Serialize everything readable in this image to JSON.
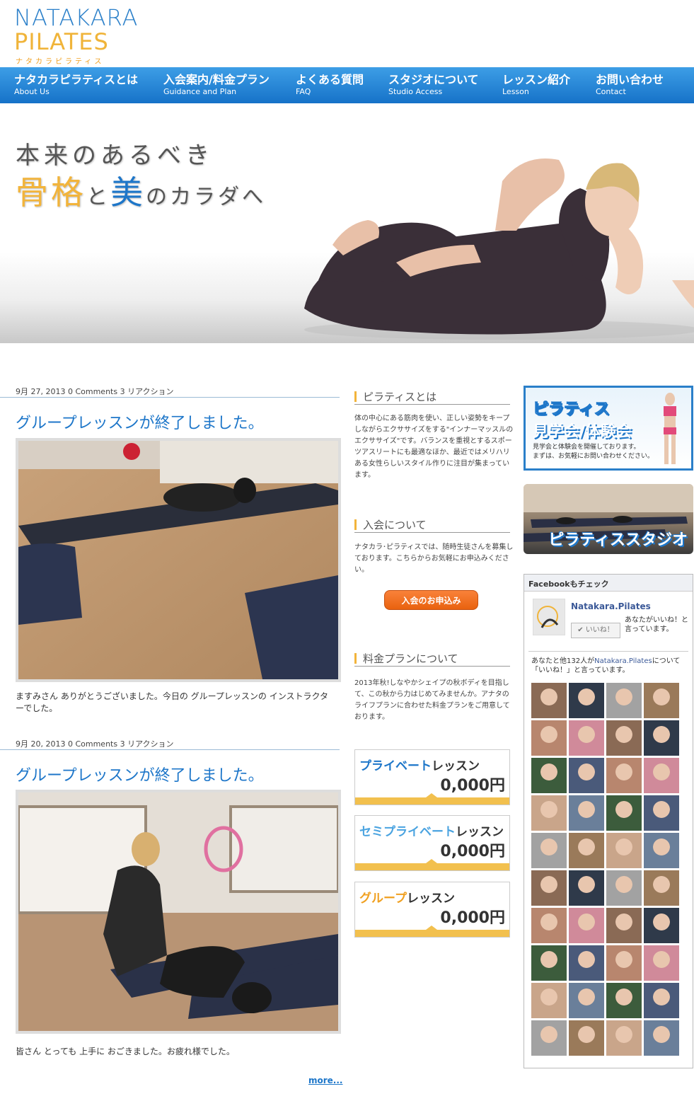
{
  "logo": {
    "line1": "NATAKARA",
    "line2": "PILATES",
    "kana": "ナタカラピラティス"
  },
  "nav": [
    {
      "jp": "ナタカラピラティスとは",
      "en": "About Us"
    },
    {
      "jp": "入会案内/料金プラン",
      "en": "Guidance and Plan"
    },
    {
      "jp": "よくある質問",
      "en": "FAQ"
    },
    {
      "jp": "スタジオについて",
      "en": "Studio Access"
    },
    {
      "jp": "レッスン紹介",
      "en": "Lesson"
    },
    {
      "jp": "お問い合わせ",
      "en": "Contact"
    }
  ],
  "hero": {
    "line1": "本来のあるべき",
    "line2_gold": "骨格",
    "line2_mid": "と",
    "line2_blue": "美",
    "line2_rest": "のカラダへ"
  },
  "posts": [
    {
      "meta": "9月 27, 2013 0 Comments 3 リアクション",
      "title": "グループレッスンが終了しました。",
      "body": "ますみさん ありがとうございました。今日の グループレッスンの インストラクターでした。"
    },
    {
      "meta": "9月 20, 2013 0 Comments 3 リアクション",
      "title": "グループレッスンが終了しました。",
      "body": "皆さん とっても 上手に おごきました。お疲れ様でした。"
    }
  ],
  "more": "more...",
  "middle": {
    "about_heading": "ピラティスとは",
    "about_text": "体の中心にある筋肉を使い、正しい姿勢をキープしながらエクササイズをする\"インナーマッスルのエクササイズ\"です。バランスを重視とするスポーツアスリートにも最適なほか、最近ではメリハリある女性らしいスタイル作りに注目が集まっています。",
    "join_heading": "入会について",
    "join_text": "ナタカラ･ピラティスでは、随時生徒さんを募集しております。こちらからお気軽にお申込みください。",
    "join_button": "入会のお申込み",
    "price_heading": "料金プランについて",
    "price_text": "2013年秋!しなやかシェイプの秋ボディを目指して、この秋から力はじめてみませんか。アナタのライフプランに合わせた料金プランをご用意しております。",
    "prices": [
      {
        "highlight": "プライベート",
        "rest": "レッスン",
        "value": "0,000円",
        "color": "#1d76c9"
      },
      {
        "highlight": "セミプライベート",
        "rest": "レッスン",
        "value": "0,000円",
        "color": "#4aa3e0"
      },
      {
        "highlight": "グループ",
        "rest": "レッスン",
        "value": "0,000円",
        "color": "#f0a020"
      }
    ]
  },
  "right": {
    "trial_line1": "ピラティス",
    "trial_line2": "見学会/体験会",
    "trial_sub1": "見学会と体験会を開催しております。",
    "trial_sub2": "まずは、お気軽にお問い合わせください。",
    "studio_label": "ピラティススタジオ",
    "fb_head": "Facebookもチェック",
    "fb_page": "Natakara.Pilates",
    "fb_like_btn": "✔ いいね！",
    "fb_like_text": "あなたがいいね！と言っています。",
    "fb_count_pre": "あなたと他132人が",
    "fb_count_link": "Natakara.Pilates",
    "fb_count_post": "について「いいね！」と言っています。"
  }
}
